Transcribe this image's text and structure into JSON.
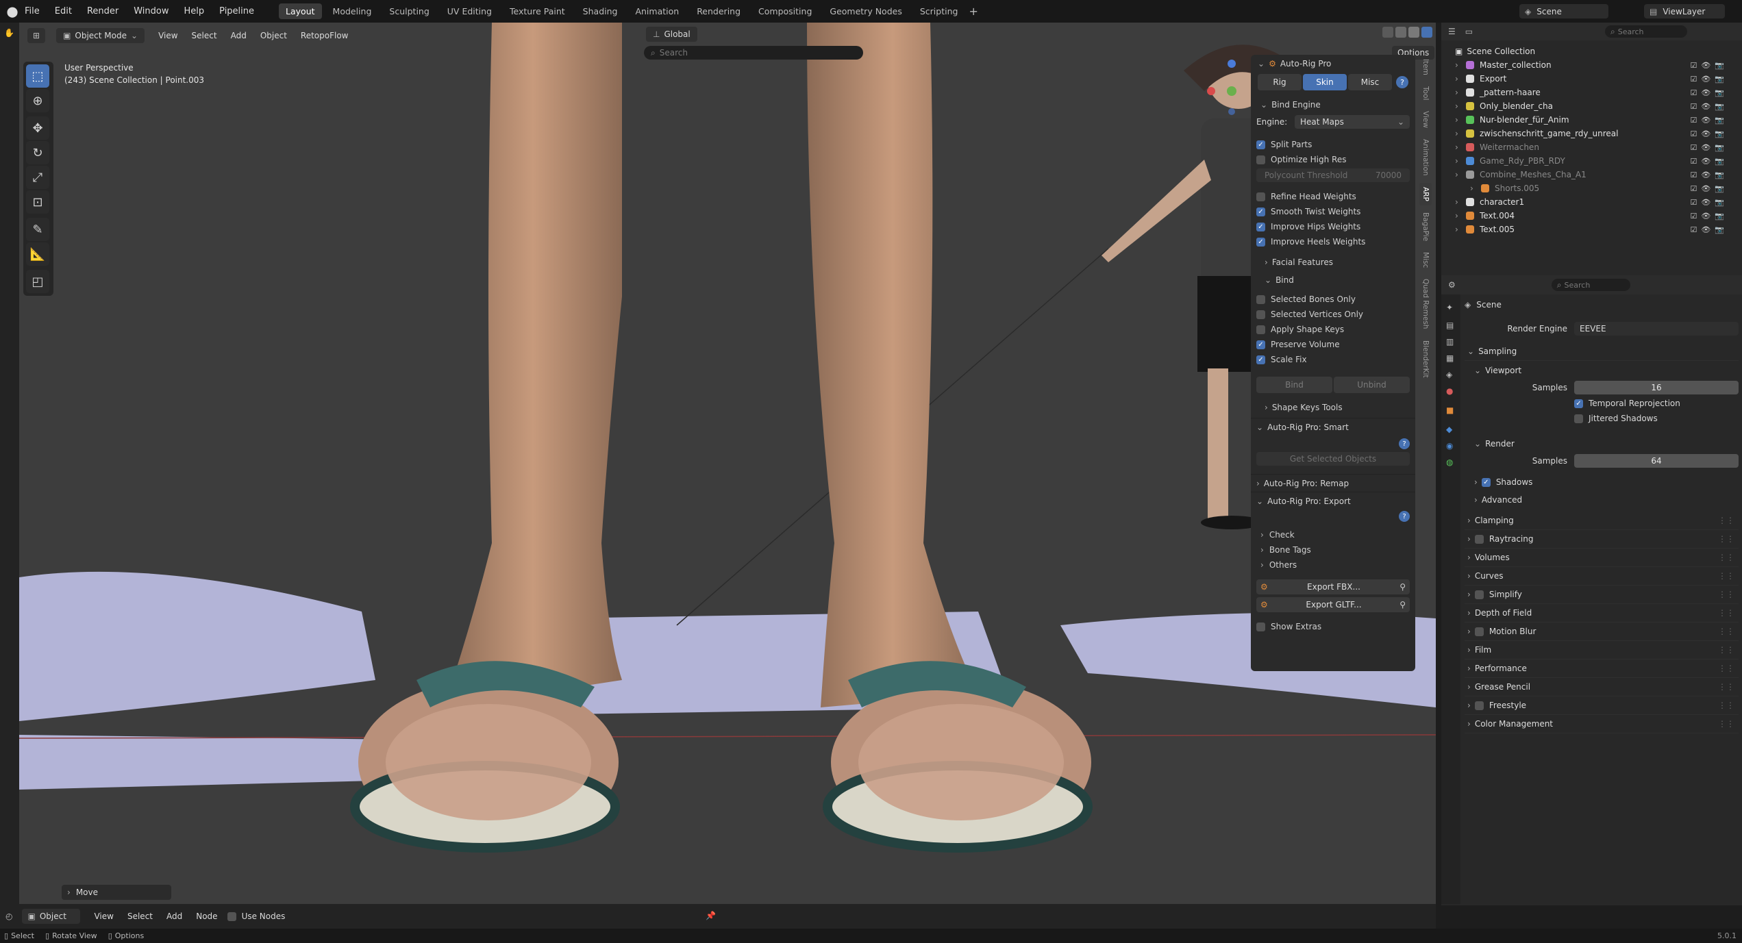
{
  "topbar": {
    "menus": [
      "File",
      "Edit",
      "Render",
      "Window",
      "Help",
      "Pipeline"
    ],
    "workspaces": [
      "Layout",
      "Modeling",
      "Sculpting",
      "UV Editing",
      "Texture Paint",
      "Shading",
      "Animation",
      "Rendering",
      "Compositing",
      "Geometry Nodes",
      "Scripting"
    ],
    "active_workspace": "Layout",
    "add_icon": "plus-icon",
    "scene_label": "Scene",
    "viewlayer_label": "ViewLayer"
  },
  "viewport_header": {
    "mode": "Object Mode",
    "menus": [
      "View",
      "Select",
      "Add",
      "Object",
      "RetopoFlow"
    ],
    "orientation": "Global",
    "search_placeholder": "Search",
    "options_label": "Options"
  },
  "viewport_overlay": {
    "perspective": "User Perspective",
    "selection": "(243) Scene Collection | Point.003",
    "operator_panel": "Move"
  },
  "npanel": {
    "title": "Auto-Rig Pro",
    "tabs": [
      "Rig",
      "Skin",
      "Misc"
    ],
    "active_tab": "Skin",
    "bind_engine_label": "Bind Engine",
    "engine_label": "Engine:",
    "engine_value": "Heat Maps",
    "split_parts": "Split Parts",
    "optimize_high_res": "Optimize High Res",
    "polycount_label": "Polycount Threshold",
    "polycount_value": "70000",
    "refine_head": "Refine Head Weights",
    "smooth_twist": "Smooth Twist Weights",
    "improve_hips": "Improve Hips Weights",
    "improve_heels": "Improve Heels Weights",
    "facial_features": "Facial Features",
    "bind_section": "Bind",
    "selected_bones_only": "Selected Bones Only",
    "selected_vertices_only": "Selected Vertices Only",
    "apply_shape_keys": "Apply Shape Keys",
    "preserve_volume": "Preserve Volume",
    "scale_fix": "Scale Fix",
    "bind_btn": "Bind",
    "unbind_btn": "Unbind",
    "shape_keys_tools": "Shape Keys Tools",
    "smart_title": "Auto-Rig Pro: Smart",
    "get_selected": "Get Selected Objects",
    "remap_title": "Auto-Rig Pro: Remap",
    "export_title": "Auto-Rig Pro: Export",
    "check": "Check",
    "bone_tags": "Bone Tags",
    "others": "Others",
    "export_fbx": "Export FBX...",
    "export_gltf": "Export GLTF...",
    "show_extras": "Show Extras"
  },
  "vtabs": [
    "Item",
    "Tool",
    "View",
    "Animation",
    "ARP",
    "BagaPie",
    "Misc",
    "Quad Remesh",
    "BlenderKit"
  ],
  "outliner": {
    "search_placeholder": "Search",
    "root": "Scene Collection",
    "items": [
      {
        "name": "Master_collection",
        "color": "#b56fd6",
        "dim": false
      },
      {
        "name": "Export",
        "color": "#e0e0e0",
        "dim": false
      },
      {
        "name": "_pattern-haare",
        "color": "#e0e0e0",
        "dim": false
      },
      {
        "name": "Only_blender_cha",
        "color": "#d6c240",
        "dim": false
      },
      {
        "name": "Nur-blender_für_Anim",
        "color": "#58c25a",
        "dim": false
      },
      {
        "name": "zwischenschritt_game_rdy_unreal",
        "color": "#d6c240",
        "dim": false
      },
      {
        "name": "Weitermachen",
        "color": "#d65b5b",
        "dim": true
      },
      {
        "name": "Game_Rdy_PBR_RDY",
        "color": "#4d8bd6",
        "dim": true
      },
      {
        "name": "Combine_Meshes_Cha_A1",
        "color": "#9a9a9a",
        "dim": true
      },
      {
        "name": "Shorts.005",
        "color": "#e08a3a",
        "dim": true
      },
      {
        "name": "character1",
        "color": "#e0e0e0",
        "dim": false
      },
      {
        "name": "Text.004",
        "color": "#e08a3a",
        "dim": false
      },
      {
        "name": "Text.005",
        "color": "#e08a3a",
        "dim": false
      }
    ]
  },
  "properties": {
    "search_placeholder": "Search",
    "scene_label": "Scene",
    "render_engine_label": "Render Engine",
    "render_engine_value": "EEVEE",
    "sampling": "Sampling",
    "viewport": "Viewport",
    "samples_label": "Samples",
    "viewport_samples": "16",
    "temporal_reprojection": "Temporal Reprojection",
    "jittered_shadows": "Jittered Shadows",
    "render": "Render",
    "render_samples": "64",
    "shadows": "Shadows",
    "advanced": "Advanced",
    "sections": [
      "Clamping",
      "Raytracing",
      "Volumes",
      "Curves",
      "Simplify",
      "Depth of Field",
      "Motion Blur",
      "Film",
      "Performance",
      "Grease Pencil",
      "Freestyle",
      "Color Management"
    ]
  },
  "bottom_header": {
    "editor": "Object",
    "menus": [
      "View",
      "Select",
      "Add",
      "Node"
    ],
    "use_nodes": "Use Nodes"
  },
  "statusbar": {
    "select": "Select",
    "rotate": "Rotate View",
    "options": "Options",
    "version": "5.0.1"
  }
}
